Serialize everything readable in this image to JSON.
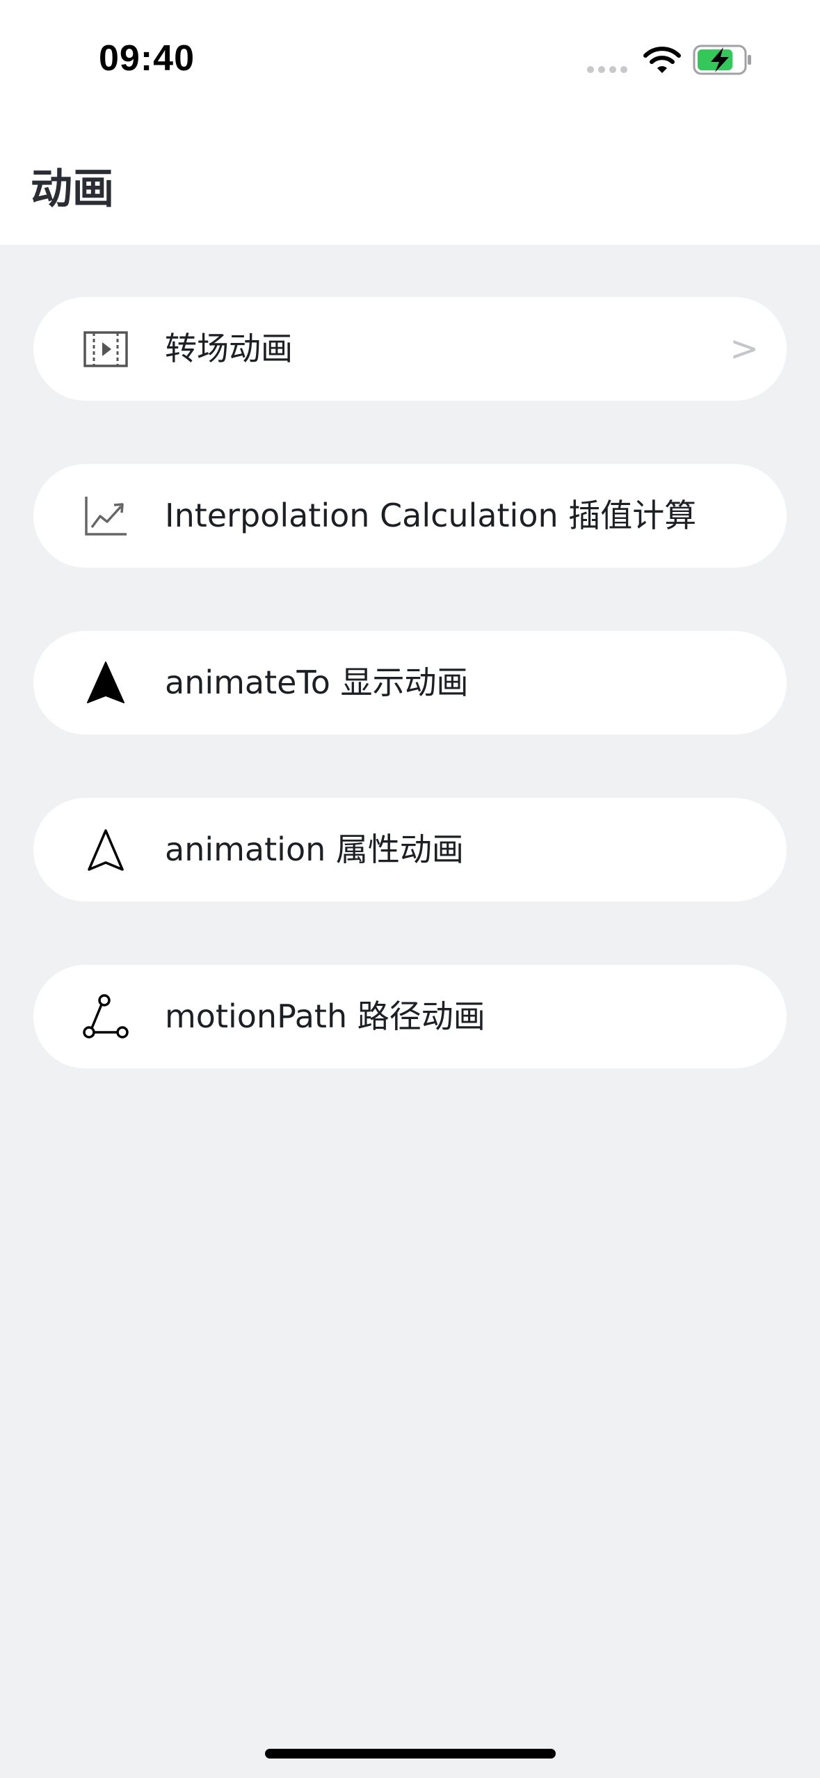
{
  "status_bar": {
    "time": "09:40",
    "battery_color": "#34c759"
  },
  "header": {
    "title": "动画"
  },
  "menu": {
    "items": [
      {
        "label": "转场动画",
        "icon": "film-play-icon",
        "chevron": ">"
      },
      {
        "label": "Interpolation Calculation 插值计算",
        "icon": "line-chart-icon"
      },
      {
        "label": "animateTo 显示动画",
        "icon": "navigation-arrow-filled-icon"
      },
      {
        "label": "animation 属性动画",
        "icon": "navigation-arrow-outline-icon"
      },
      {
        "label": "motionPath 路径动画",
        "icon": "path-nodes-icon"
      }
    ]
  }
}
